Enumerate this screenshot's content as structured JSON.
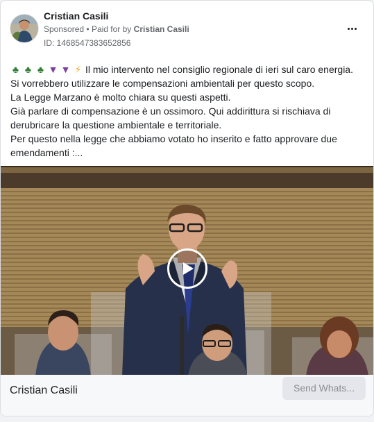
{
  "post": {
    "advertiser_name": "Cristian Casili",
    "sponsored_label": "Sponsored",
    "separator": "•",
    "paid_for_by_label": "Paid for by",
    "paid_for_by_name": "Cristian Casili",
    "library_id": "ID: 1468547383652856",
    "more_icon": "more-horizontal-icon"
  },
  "body": {
    "emojis": [
      "tree",
      "tree",
      "tree",
      "grapes",
      "grapes",
      "high-voltage"
    ],
    "lines": [
      "Il mio intervento nel consiglio regionale di ieri sul caro energia.",
      "Si vorrebbero utilizzare le compensazioni ambientali per questo scopo.",
      "La Legge Marzano è molto chiara su questi aspetti.",
      "Già parlare di compensazione è un ossimoro. Qui addirittura si rischiava di",
      "derubricare la questione ambientale e territoriale.",
      "Per questo nella legge che abbiamo votato ho inserito e fatto approvare due",
      "emendamenti :..."
    ]
  },
  "media": {
    "type": "video",
    "play_icon": "play-icon"
  },
  "footer": {
    "page_name": "Cristian Casili",
    "cta_label": "Send Whats..."
  },
  "colors": {
    "text_primary": "#1c1e21",
    "text_secondary": "#65676b",
    "button_bg": "#e4e6eb",
    "button_text": "#8a8d91"
  }
}
